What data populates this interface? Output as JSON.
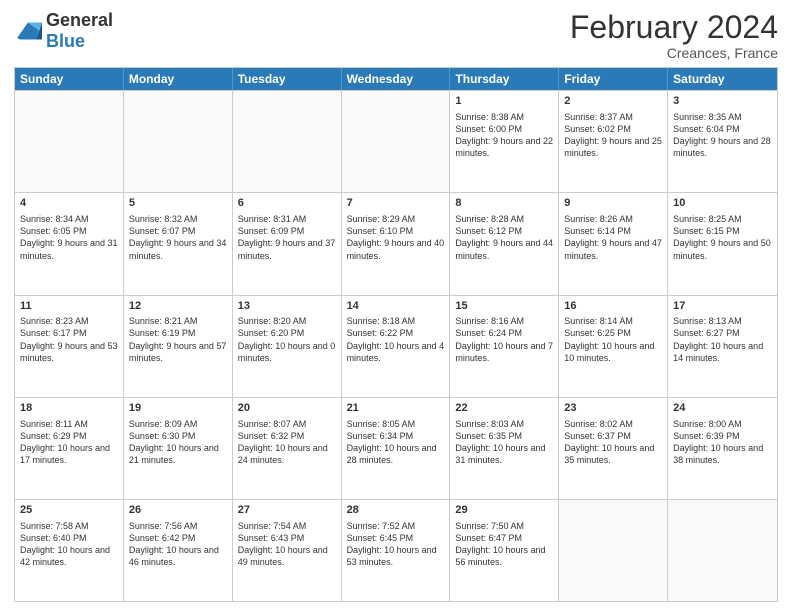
{
  "header": {
    "logo_general": "General",
    "logo_blue": "Blue",
    "month": "February 2024",
    "location": "Creances, France"
  },
  "days_of_week": [
    "Sunday",
    "Monday",
    "Tuesday",
    "Wednesday",
    "Thursday",
    "Friday",
    "Saturday"
  ],
  "weeks": [
    [
      {
        "day": "",
        "empty": true
      },
      {
        "day": "",
        "empty": true
      },
      {
        "day": "",
        "empty": true
      },
      {
        "day": "",
        "empty": true
      },
      {
        "day": "1",
        "sunrise": "Sunrise: 8:38 AM",
        "sunset": "Sunset: 6:00 PM",
        "daylight": "Daylight: 9 hours and 22 minutes."
      },
      {
        "day": "2",
        "sunrise": "Sunrise: 8:37 AM",
        "sunset": "Sunset: 6:02 PM",
        "daylight": "Daylight: 9 hours and 25 minutes."
      },
      {
        "day": "3",
        "sunrise": "Sunrise: 8:35 AM",
        "sunset": "Sunset: 6:04 PM",
        "daylight": "Daylight: 9 hours and 28 minutes."
      }
    ],
    [
      {
        "day": "4",
        "sunrise": "Sunrise: 8:34 AM",
        "sunset": "Sunset: 6:05 PM",
        "daylight": "Daylight: 9 hours and 31 minutes."
      },
      {
        "day": "5",
        "sunrise": "Sunrise: 8:32 AM",
        "sunset": "Sunset: 6:07 PM",
        "daylight": "Daylight: 9 hours and 34 minutes."
      },
      {
        "day": "6",
        "sunrise": "Sunrise: 8:31 AM",
        "sunset": "Sunset: 6:09 PM",
        "daylight": "Daylight: 9 hours and 37 minutes."
      },
      {
        "day": "7",
        "sunrise": "Sunrise: 8:29 AM",
        "sunset": "Sunset: 6:10 PM",
        "daylight": "Daylight: 9 hours and 40 minutes."
      },
      {
        "day": "8",
        "sunrise": "Sunrise: 8:28 AM",
        "sunset": "Sunset: 6:12 PM",
        "daylight": "Daylight: 9 hours and 44 minutes."
      },
      {
        "day": "9",
        "sunrise": "Sunrise: 8:26 AM",
        "sunset": "Sunset: 6:14 PM",
        "daylight": "Daylight: 9 hours and 47 minutes."
      },
      {
        "day": "10",
        "sunrise": "Sunrise: 8:25 AM",
        "sunset": "Sunset: 6:15 PM",
        "daylight": "Daylight: 9 hours and 50 minutes."
      }
    ],
    [
      {
        "day": "11",
        "sunrise": "Sunrise: 8:23 AM",
        "sunset": "Sunset: 6:17 PM",
        "daylight": "Daylight: 9 hours and 53 minutes."
      },
      {
        "day": "12",
        "sunrise": "Sunrise: 8:21 AM",
        "sunset": "Sunset: 6:19 PM",
        "daylight": "Daylight: 9 hours and 57 minutes."
      },
      {
        "day": "13",
        "sunrise": "Sunrise: 8:20 AM",
        "sunset": "Sunset: 6:20 PM",
        "daylight": "Daylight: 10 hours and 0 minutes."
      },
      {
        "day": "14",
        "sunrise": "Sunrise: 8:18 AM",
        "sunset": "Sunset: 6:22 PM",
        "daylight": "Daylight: 10 hours and 4 minutes."
      },
      {
        "day": "15",
        "sunrise": "Sunrise: 8:16 AM",
        "sunset": "Sunset: 6:24 PM",
        "daylight": "Daylight: 10 hours and 7 minutes."
      },
      {
        "day": "16",
        "sunrise": "Sunrise: 8:14 AM",
        "sunset": "Sunset: 6:25 PM",
        "daylight": "Daylight: 10 hours and 10 minutes."
      },
      {
        "day": "17",
        "sunrise": "Sunrise: 8:13 AM",
        "sunset": "Sunset: 6:27 PM",
        "daylight": "Daylight: 10 hours and 14 minutes."
      }
    ],
    [
      {
        "day": "18",
        "sunrise": "Sunrise: 8:11 AM",
        "sunset": "Sunset: 6:29 PM",
        "daylight": "Daylight: 10 hours and 17 minutes."
      },
      {
        "day": "19",
        "sunrise": "Sunrise: 8:09 AM",
        "sunset": "Sunset: 6:30 PM",
        "daylight": "Daylight: 10 hours and 21 minutes."
      },
      {
        "day": "20",
        "sunrise": "Sunrise: 8:07 AM",
        "sunset": "Sunset: 6:32 PM",
        "daylight": "Daylight: 10 hours and 24 minutes."
      },
      {
        "day": "21",
        "sunrise": "Sunrise: 8:05 AM",
        "sunset": "Sunset: 6:34 PM",
        "daylight": "Daylight: 10 hours and 28 minutes."
      },
      {
        "day": "22",
        "sunrise": "Sunrise: 8:03 AM",
        "sunset": "Sunset: 6:35 PM",
        "daylight": "Daylight: 10 hours and 31 minutes."
      },
      {
        "day": "23",
        "sunrise": "Sunrise: 8:02 AM",
        "sunset": "Sunset: 6:37 PM",
        "daylight": "Daylight: 10 hours and 35 minutes."
      },
      {
        "day": "24",
        "sunrise": "Sunrise: 8:00 AM",
        "sunset": "Sunset: 6:39 PM",
        "daylight": "Daylight: 10 hours and 38 minutes."
      }
    ],
    [
      {
        "day": "25",
        "sunrise": "Sunrise: 7:58 AM",
        "sunset": "Sunset: 6:40 PM",
        "daylight": "Daylight: 10 hours and 42 minutes."
      },
      {
        "day": "26",
        "sunrise": "Sunrise: 7:56 AM",
        "sunset": "Sunset: 6:42 PM",
        "daylight": "Daylight: 10 hours and 46 minutes."
      },
      {
        "day": "27",
        "sunrise": "Sunrise: 7:54 AM",
        "sunset": "Sunset: 6:43 PM",
        "daylight": "Daylight: 10 hours and 49 minutes."
      },
      {
        "day": "28",
        "sunrise": "Sunrise: 7:52 AM",
        "sunset": "Sunset: 6:45 PM",
        "daylight": "Daylight: 10 hours and 53 minutes."
      },
      {
        "day": "29",
        "sunrise": "Sunrise: 7:50 AM",
        "sunset": "Sunset: 6:47 PM",
        "daylight": "Daylight: 10 hours and 56 minutes."
      },
      {
        "day": "",
        "empty": true
      },
      {
        "day": "",
        "empty": true
      }
    ]
  ]
}
